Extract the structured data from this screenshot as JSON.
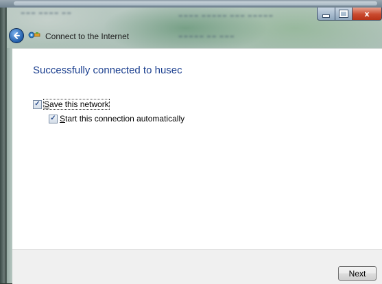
{
  "window": {
    "title": "Connect to the Internet",
    "caption_buttons": [
      "minimize",
      "maximize",
      "close"
    ],
    "close_glyph": "x"
  },
  "nav": {
    "back_icon": "back-arrow-icon",
    "app_icon": "network-connection-icon"
  },
  "content": {
    "heading": "Successfully connected to husec",
    "save_network": {
      "label": "Save this network",
      "accel": "S",
      "checked": true,
      "checkmark": "✓"
    },
    "auto_connect": {
      "label": "Start this connection automatically",
      "accel": "S",
      "checked": true,
      "checkmark": "✓"
    }
  },
  "footer": {
    "next_label": "Next"
  }
}
